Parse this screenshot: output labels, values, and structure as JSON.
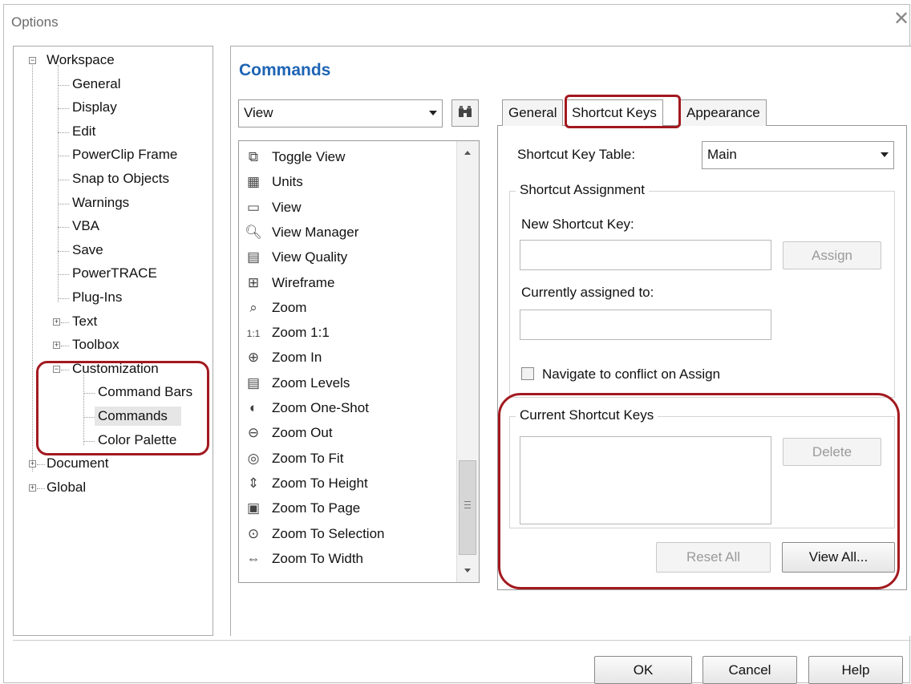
{
  "window": {
    "title": "Options",
    "close_glyph": "✕"
  },
  "tree": {
    "workspace": "Workspace",
    "workspace_children": [
      "General",
      "Display",
      "Edit",
      "PowerClip Frame",
      "Snap to Objects",
      "Warnings",
      "VBA",
      "Save",
      "PowerTRACE",
      "Plug-Ins"
    ],
    "text": "Text",
    "toolbox": "Toolbox",
    "customization": "Customization",
    "customization_children": [
      "Command Bars",
      "Commands",
      "Color Palette"
    ],
    "selected": "Commands",
    "document": "Document",
    "global": "Global"
  },
  "panel": {
    "heading": "Commands",
    "category_combo": "View",
    "find_icon": "binoculars-icon"
  },
  "commands_list": [
    {
      "label": "Toggle View",
      "icon": "toggle-view-icon"
    },
    {
      "label": "Units",
      "icon": "units-icon"
    },
    {
      "label": "View",
      "icon": "view-icon"
    },
    {
      "label": "View Manager",
      "icon": "view-manager-icon"
    },
    {
      "label": "View Quality",
      "icon": "view-quality-icon"
    },
    {
      "label": "Wireframe",
      "icon": "wireframe-icon"
    },
    {
      "label": "Zoom",
      "icon": "zoom-icon"
    },
    {
      "label": "Zoom 1:1",
      "icon": "zoom-1-1-icon"
    },
    {
      "label": "Zoom In",
      "icon": "zoom-in-icon"
    },
    {
      "label": "Zoom Levels",
      "icon": "zoom-levels-icon"
    },
    {
      "label": "Zoom One-Shot",
      "icon": "zoom-one-shot-icon"
    },
    {
      "label": "Zoom Out",
      "icon": "zoom-out-icon"
    },
    {
      "label": "Zoom To Fit",
      "icon": "zoom-to-fit-icon"
    },
    {
      "label": "Zoom To Height",
      "icon": "zoom-to-height-icon"
    },
    {
      "label": "Zoom To Page",
      "icon": "zoom-to-page-icon"
    },
    {
      "label": "Zoom To Selection",
      "icon": "zoom-to-selection-icon"
    },
    {
      "label": "Zoom To Width",
      "icon": "zoom-to-width-icon"
    }
  ],
  "tabs": [
    "General",
    "Shortcut Keys",
    "Appearance"
  ],
  "active_tab": "Shortcut Keys",
  "shortcut": {
    "table_label": "Shortcut Key Table:",
    "table_value": "Main",
    "assignment_group": "Shortcut Assignment",
    "new_key_label": "New Shortcut Key:",
    "new_key_value": "",
    "assign_button": "Assign",
    "assigned_to_label": "Currently assigned to:",
    "assigned_to_value": "",
    "navigate_checkbox": "Navigate to conflict on Assign",
    "navigate_checked": false,
    "current_group": "Current Shortcut Keys",
    "delete_button": "Delete",
    "reset_all_button": "Reset All",
    "view_all_button": "View All..."
  },
  "footer": {
    "ok": "OK",
    "cancel": "Cancel",
    "help": "Help"
  },
  "colors": {
    "highlight": "#a2191f",
    "heading": "#1e64b4"
  }
}
